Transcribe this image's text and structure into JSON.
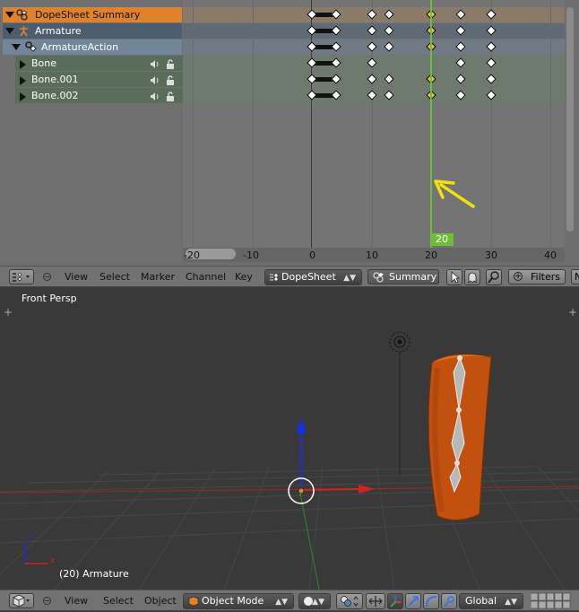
{
  "dopesheet": {
    "channels": {
      "summary": "DopeSheet Summary",
      "armature": "Armature",
      "action": "ArmatureAction",
      "bones": [
        "Bone",
        "Bone.001",
        "Bone.002"
      ]
    },
    "current_frame": "20",
    "ruler_ticks": [
      "-20",
      "-10",
      "0",
      "10",
      "20",
      "30",
      "40"
    ],
    "keyframes": {
      "summary": [
        0,
        4,
        10,
        13,
        20,
        25,
        30
      ],
      "bone": [
        0,
        4,
        10,
        25,
        30
      ],
      "bone_001": [
        0,
        4,
        10,
        13,
        20,
        25,
        30
      ],
      "bone_002": [
        0,
        4,
        10,
        13,
        20,
        25,
        30
      ]
    },
    "selected_frame": 20,
    "colors": {
      "summary_row": "#e0822c",
      "current_frame": "#6ebe3b",
      "selected_key": "#e8c43b",
      "annotation_arrow": "#f3e10b"
    }
  },
  "ds_header": {
    "menus": [
      "View",
      "Select",
      "Marker",
      "Channel",
      "Key"
    ],
    "mode_dropdown": "DopeSheet",
    "summary_button": "Summary",
    "filters_button": "Filters",
    "overflow": "N"
  },
  "viewport": {
    "title": "Front Persp",
    "object_label": "(20) Armature",
    "colors": {
      "mesh": "#d45a10",
      "x_axis": "#d82020",
      "z_axis": "#1a2ee0",
      "y_axis": "#20b020"
    }
  },
  "vp_header": {
    "menus": [
      "View",
      "Select",
      "Object"
    ],
    "mode_dropdown": "Object Mode",
    "orientation_dropdown": "Global"
  }
}
